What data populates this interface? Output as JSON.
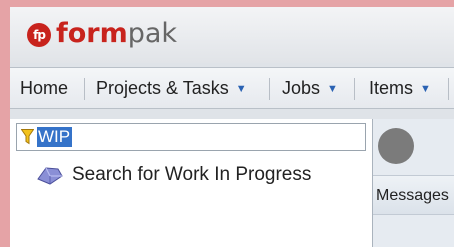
{
  "brand": {
    "mark": "fp",
    "name_part1": "form",
    "name_part2": "pak"
  },
  "nav": {
    "items": [
      {
        "label": "Home",
        "has_dropdown": false
      },
      {
        "label": "Projects & Tasks",
        "has_dropdown": true
      },
      {
        "label": "Jobs",
        "has_dropdown": true
      },
      {
        "label": "Items",
        "has_dropdown": true
      }
    ]
  },
  "filter": {
    "icon": "filter-funnel-icon",
    "value": "WIP"
  },
  "tree": {
    "items": [
      {
        "icon": "search-query-icon",
        "label": "Search for Work In Progress"
      }
    ]
  },
  "right_panel": {
    "messages_label": "Messages"
  },
  "colors": {
    "brand_red": "#c8231d",
    "selection_blue": "#3573c9",
    "outer_bg": "#e5a3a6"
  }
}
